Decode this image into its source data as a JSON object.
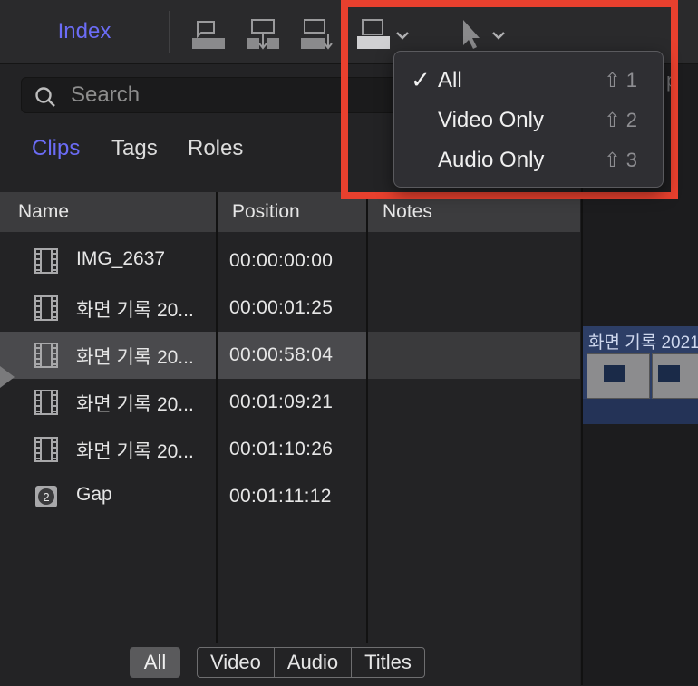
{
  "toolbar": {
    "index_label": "Index"
  },
  "search": {
    "placeholder": "Search"
  },
  "subtabs": [
    "Clips",
    "Tags",
    "Roles"
  ],
  "table": {
    "columns": [
      "Name",
      "Position",
      "Notes"
    ],
    "rows": [
      {
        "name": "IMG_2637",
        "position": "00:00:00:00",
        "icon": "film-icon"
      },
      {
        "name": "화면 기록 20...",
        "position": "00:00:01:25",
        "icon": "film-icon"
      },
      {
        "name": "화면 기록 20...",
        "position": "00:00:58:04",
        "icon": "film-icon",
        "selected": true
      },
      {
        "name": "화면 기록 20...",
        "position": "00:01:09:21",
        "icon": "film-icon"
      },
      {
        "name": "화면 기록 20...",
        "position": "00:01:10:26",
        "icon": "film-icon"
      },
      {
        "name": "Gap",
        "position": "00:01:11:12",
        "icon": "gap-icon"
      }
    ]
  },
  "filters": {
    "all": "All",
    "video": "Video",
    "audio": "Audio",
    "titles": "Titles"
  },
  "dropdown": {
    "items": [
      {
        "label": "All",
        "shortcut": "⇧ 1",
        "checked": true
      },
      {
        "label": "Video Only",
        "shortcut": "⇧ 2",
        "checked": false
      },
      {
        "label": "Audio Only",
        "shortcut": "⇧ 3",
        "checked": false
      }
    ],
    "check_glyph": "✓"
  },
  "timeline": {
    "clip_title": "화면 기록 2021"
  },
  "colors": {
    "accent": "#6b6cf5",
    "highlight": "#e8402e",
    "timeline_clip": "#2d3e66"
  }
}
